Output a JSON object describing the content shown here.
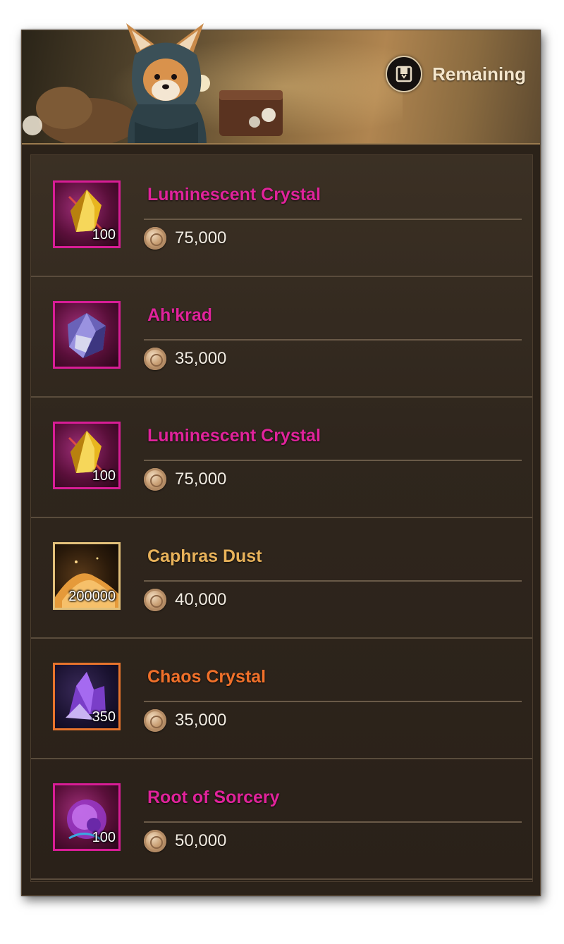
{
  "header": {
    "remaining_label": "Remaining",
    "icon": "shop-box-icon"
  },
  "colors": {
    "relic": "#e0239b",
    "legendary": "#e8b25a",
    "epic": "#f0702a",
    "price_text": "#f2ece2"
  },
  "items": [
    {
      "name": "Luminescent Crystal",
      "qty": "100",
      "price": "75,000",
      "grade": "relic",
      "icon": "luminescent-crystal-icon"
    },
    {
      "name": "Ah'krad",
      "qty": "",
      "price": "35,000",
      "grade": "relic",
      "icon": "ahkrad-icon"
    },
    {
      "name": "Luminescent Crystal",
      "qty": "100",
      "price": "75,000",
      "grade": "relic",
      "icon": "luminescent-crystal-icon"
    },
    {
      "name": "Caphras Dust",
      "qty": "200000",
      "price": "40,000",
      "grade": "legendary",
      "icon": "caphras-dust-icon"
    },
    {
      "name": "Chaos Crystal",
      "qty": "350",
      "price": "35,000",
      "grade": "epic",
      "icon": "chaos-crystal-icon"
    },
    {
      "name": "Root of Sorcery",
      "qty": "100",
      "price": "50,000",
      "grade": "relic",
      "icon": "root-of-sorcery-icon"
    }
  ]
}
